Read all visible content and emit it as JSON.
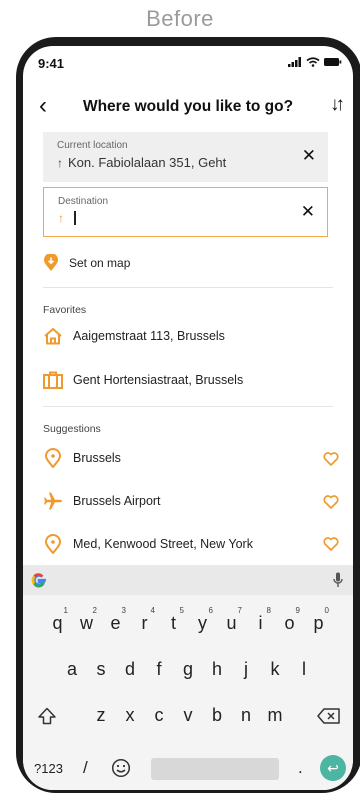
{
  "caption": "Before",
  "status": {
    "time": "9:41"
  },
  "header": {
    "title": "Where would you like to go?"
  },
  "current": {
    "label": "Current location",
    "value": "Kon. Fabiolalaan 351, Geht"
  },
  "destination": {
    "label": "Destination",
    "value": ""
  },
  "set_on_map": "Set on map",
  "favorites": {
    "heading": "Favorites",
    "items": [
      {
        "label": "Aaigemstraat 113, Brussels",
        "icon": "home-icon"
      },
      {
        "label": "Gent Hortensiastraat, Brussels",
        "icon": "briefcase-icon"
      }
    ]
  },
  "suggestions": {
    "heading": "Suggestions",
    "items": [
      {
        "label": "Brussels",
        "icon": "location-icon"
      },
      {
        "label": "Brussels Airport",
        "icon": "airplane-icon"
      },
      {
        "label": "Med, Kenwood Street, New York",
        "icon": "location-icon"
      }
    ]
  },
  "keyboard": {
    "row1": [
      "q",
      "w",
      "e",
      "r",
      "t",
      "y",
      "u",
      "i",
      "o",
      "p"
    ],
    "row1_nums": [
      "1",
      "2",
      "3",
      "4",
      "5",
      "6",
      "7",
      "8",
      "9",
      "0"
    ],
    "row2": [
      "a",
      "s",
      "d",
      "f",
      "g",
      "h",
      "j",
      "k",
      "l"
    ],
    "row3": [
      "z",
      "x",
      "c",
      "v",
      "b",
      "n",
      "m"
    ],
    "sym_key": "?123",
    "slash_key": "/",
    "period_key": "."
  },
  "colors": {
    "accent": "#f09a2e",
    "enter": "#4db6a3"
  }
}
